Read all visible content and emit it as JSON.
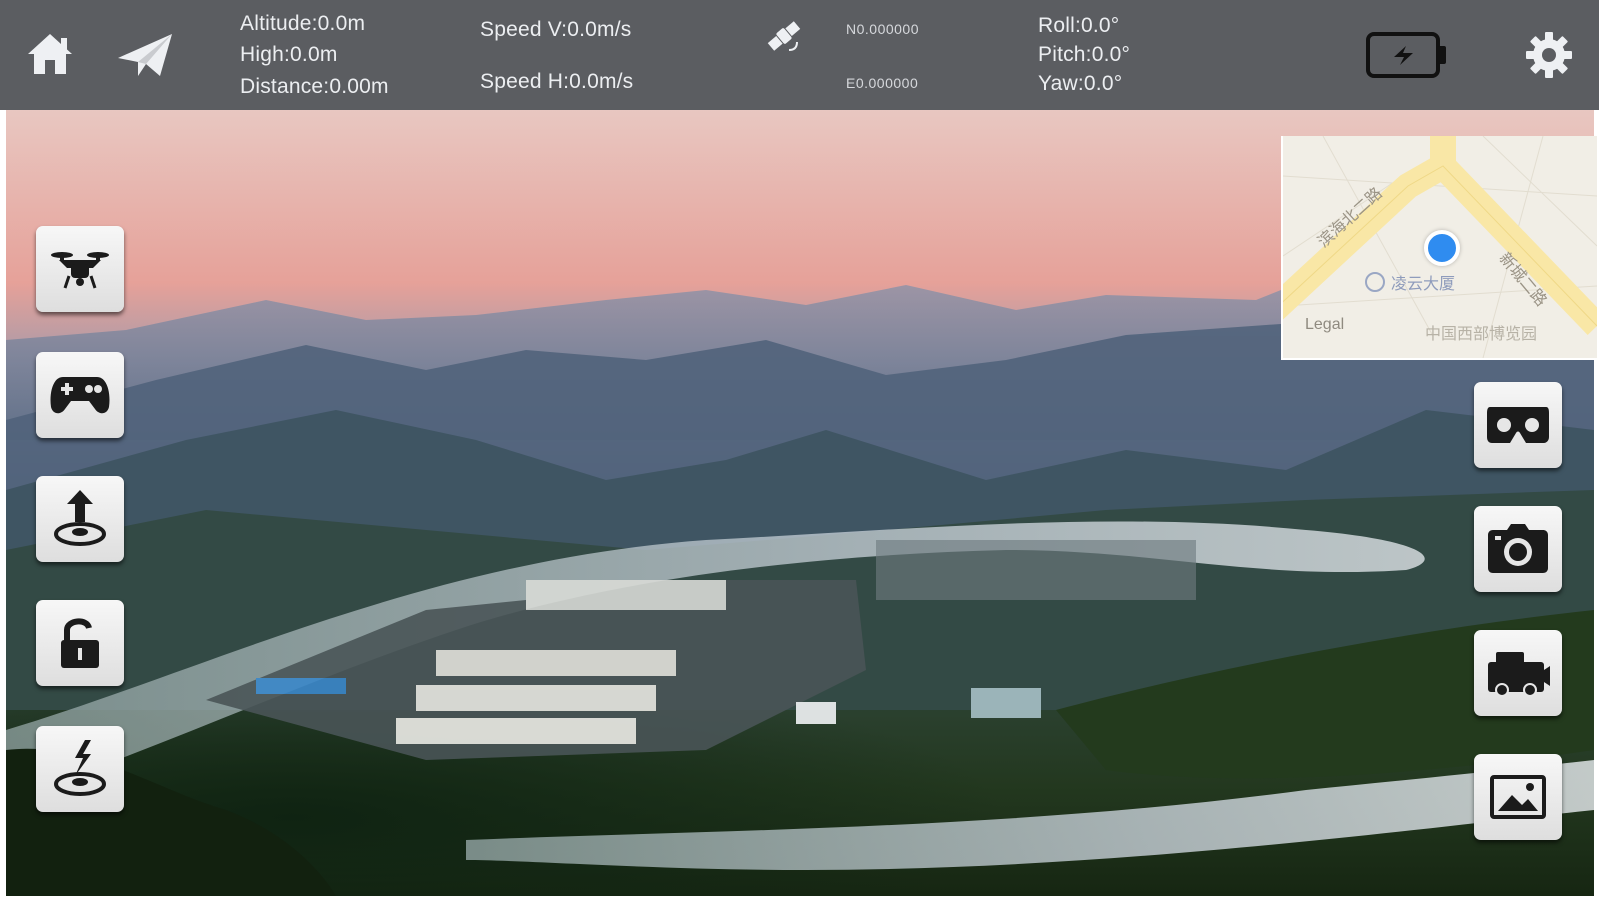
{
  "telemetry": {
    "altitude": "Altitude:0.0m",
    "high": "High:0.0m",
    "distance": "Distance:0.00m",
    "speed_v": "Speed V:0.0m/s",
    "speed_h": "Speed H:0.0m/s",
    "latitude": "N0.000000",
    "longitude": "E0.000000",
    "roll": "Roll:0.0°",
    "pitch": "Pitch:0.0°",
    "yaw": "Yaw:0.0°"
  },
  "top_icons": [
    "home-icon",
    "paper-plane-icon",
    "satellite-icon",
    "battery-icon",
    "gear-icon"
  ],
  "left_buttons": [
    "drone-icon",
    "gamepad-icon",
    "takeoff-icon",
    "unlock-icon",
    "landing-icon"
  ],
  "right_buttons": [
    "vr-glasses-icon",
    "camera-icon",
    "video-camera-icon",
    "gallery-icon"
  ],
  "map": {
    "road_left": "滨海北二路",
    "road_right": "新城二路",
    "place": "凌云大厦",
    "legal": "Legal",
    "corner_text": "中国西部博览园"
  },
  "colors": {
    "topbar": "#5b5d61",
    "button": "#e6e6e6",
    "location_dot": "#2f8cf0"
  }
}
